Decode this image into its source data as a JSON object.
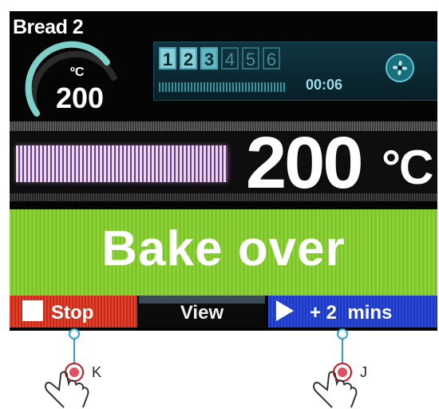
{
  "program": {
    "title": "Bread 2",
    "setpoint_unit": "ºC",
    "setpoint_value": "200",
    "setpoint_fraction": 0.55
  },
  "steps": [
    "1",
    "2",
    "3",
    "4",
    "5",
    "6"
  ],
  "current_step": "3",
  "timer": "00:06",
  "temperature": {
    "value": "200",
    "unit": "°C"
  },
  "status": "Bake over",
  "buttons": {
    "stop": "Stop",
    "view": "View",
    "add": "+ 2  mins"
  },
  "annotations": {
    "stop_marker": "K",
    "add_marker": "J"
  },
  "colors": {
    "stop": "#d93a26",
    "add": "#2442cf",
    "status": "#86cc33",
    "accent": "#5fb7c3"
  },
  "icons": [
    "fan-icon",
    "stop-square-icon",
    "play-triangle-icon",
    "tap-hand-icon"
  ]
}
